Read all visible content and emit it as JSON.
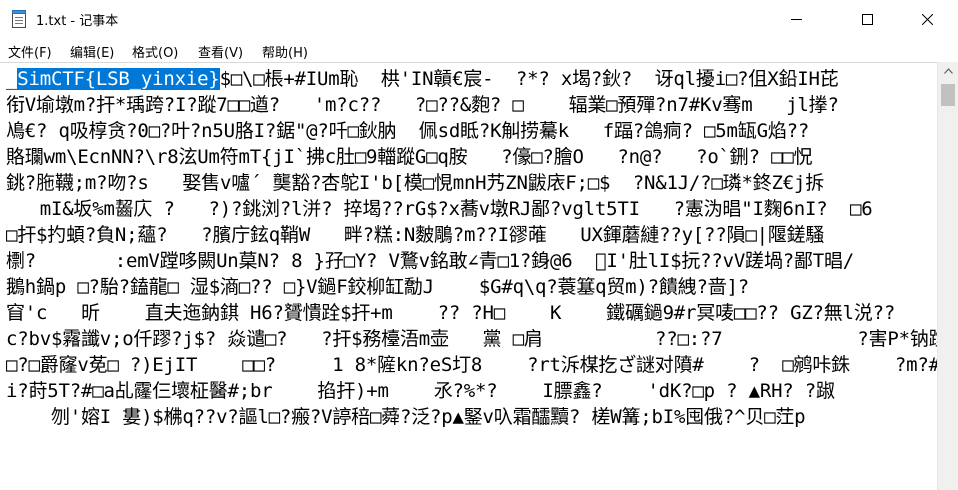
{
  "window": {
    "title": "1.txt - 记事本",
    "icons": {
      "app": "notepad-icon",
      "minimize": "minimize-icon",
      "maximize": "maximize-icon",
      "close": "close-icon",
      "scroll_up": "chevron-up-icon"
    }
  },
  "menu": {
    "items": [
      {
        "label": "文件(F)"
      },
      {
        "label": "编辑(E)"
      },
      {
        "label": "格式(O)"
      },
      {
        "label": "查看(V)"
      },
      {
        "label": "帮助(H)"
      }
    ]
  },
  "editor": {
    "selection_color": "#0078d7",
    "first_line": {
      "prefix": "_",
      "selected": "SimCTF{LSB_yinxie}",
      "rest": "$□\\□棖+#IUm恥  栱'IN贑€宸-  ?*? x堨?鈥?  讶ql擾i□?伹X鉛IH芘"
    },
    "lines": [
      "衔V堬墩m?扞*瑀跨?I?蹤7□□遒?   'm?c??   ?□??&麭? □    辐業□預殫?n7#Kv骞m   jl搼?",
      "鳰€? q吸椁贪?0□?叶?n5U胳I?鋸\"@?吀□鈥肭  佩sd眡?K觓捞驀k   f踾?鴿痌? □5m缻G焰??",
      "賂瓓wm\\EcnNN?\\r8泫Um符mT{jI`拂c肚□9輺蹤G□q胺   ?儫□?膾O   ?n@?   ?o`鉶? □□怳",
      "銚?胣韈;m?吻?s   娶售v嚧´ 龑豁?杏鸵I'b[模□悓mnH艿ZN鼥庡F;□$  ?N&1J/?□璘*鉖Z€j拆",
      "   mI&坂%m齧庂 ?   ?)?銚浏?l洴? 捽堨??rG$?x蕎v墩RJ鄙?vglt5TI   ?憲沩晿\"I麴6nI?  □6",
      "□扞$扚蝢?負N;蘊?   ?臏庁鉉q鞘W   畔?糕:N麬鵰?m??I豂蓶   UX鍕蘑縺??y[??隕□|隁鎈騷",
      "檦?       :emV蹚哆闕Un菒N? 8 }孖□Y? V鶩v銘敢∠青□1?銵@6  ゚I'肚lI$抏??vV蹉堝?鄙T晿/",
      "鵝h鍋p □?駘?鎑龍□ 湿$滳□?? □}V鐹F鉸柳缸勪J    $G#q\\q?蓑簊q贸m)?饋絏?啬]?",
      "窅'c   昕    直夫迤鈉錤 H6?贇憒跧$扞+m    ?? ?H□    K    鐵礪鐹9#r冥唛□□?? GZ?無l涚??",
      "c?bv$霿讖v;o仟蹘?j$? 焱谴□?   ?扞$務檯浯m壶   黨 □肩          ??□:?7            ?害P*钠蹚c氍",
      "□?□爵窿v莬□ ?)EjIT    □□?     1 8*隡kn?eS圢8    ?rt泝楳扢ざ謎对隫#    ?  □鹓咔銖    ?m?#扞",
      "i?莳5T?#□a乩霳仨壞柾醫#;br    掐扞)+m    氶?%*?    I膘鑫?    'dK?□p ? ▲RH? ?踧         ? □  t",
      "    刎'嫆I 婁)$梻q??v?謳l□?瘢?V諪稖□蕣?泛?p▲鋻v叺霜醽黷? 槎W篝;bI%囤俄?^贝□茳p"
    ]
  }
}
